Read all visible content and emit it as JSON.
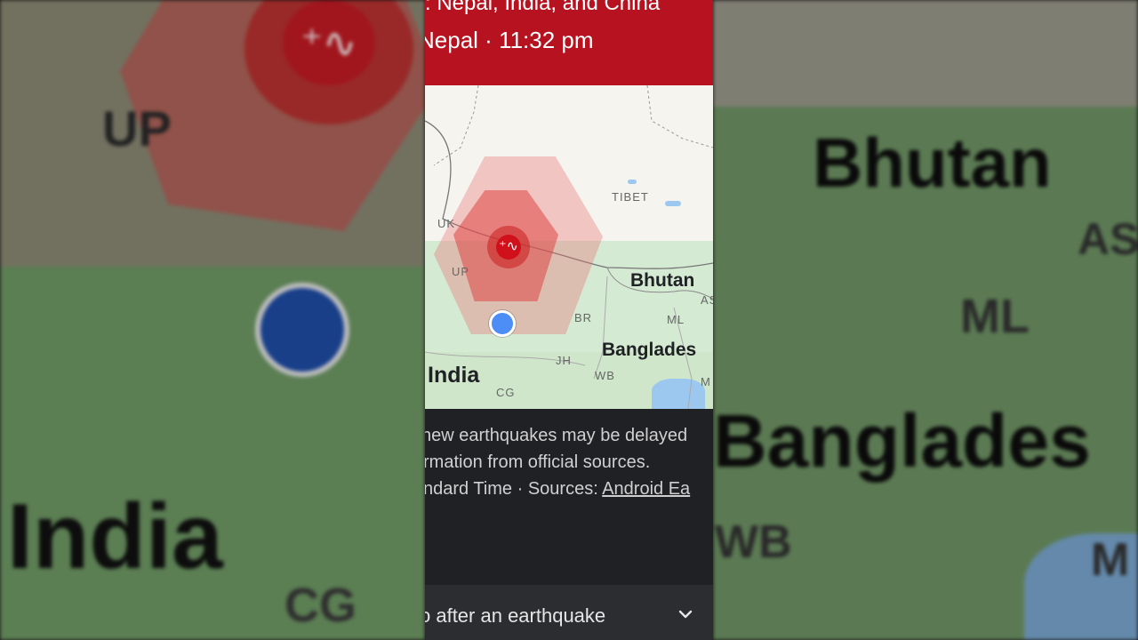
{
  "alert": {
    "line1": ": Nepal, India, and China",
    "line2": "Nepal · 11:32 pm"
  },
  "map": {
    "labels": {
      "tibet": "TIBET",
      "uk": "UK",
      "up": "UP",
      "bhutan": "Bhutan",
      "br": "BR",
      "ml": "ML",
      "as": "AS",
      "bangladesh": "Banglades",
      "jh": "JH",
      "wb": "WB",
      "m": "M",
      "india": "India",
      "cg": "CG"
    }
  },
  "info": {
    "line1": "new earthquakes may be delayed",
    "line2": "rmation from official sources.",
    "line3_prefix": "ndard Time · Sources: ",
    "line3_link": "Android Ea"
  },
  "bottom": {
    "label": "o after an earthquake",
    "chevron_icon": "chevron-down-icon"
  },
  "background": {
    "left_labels": {
      "up": "UP",
      "india": "India",
      "cg": "CG"
    },
    "right_labels": {
      "bhutan": "Bhutan",
      "as": "AS",
      "ml": "ML",
      "bangladesh": "Banglades",
      "wb": "WB",
      "m": "M"
    }
  },
  "colors": {
    "alert_red": "#b7121f",
    "epicenter_red": "#d0101a",
    "user_location_blue": "#4c8df6"
  }
}
